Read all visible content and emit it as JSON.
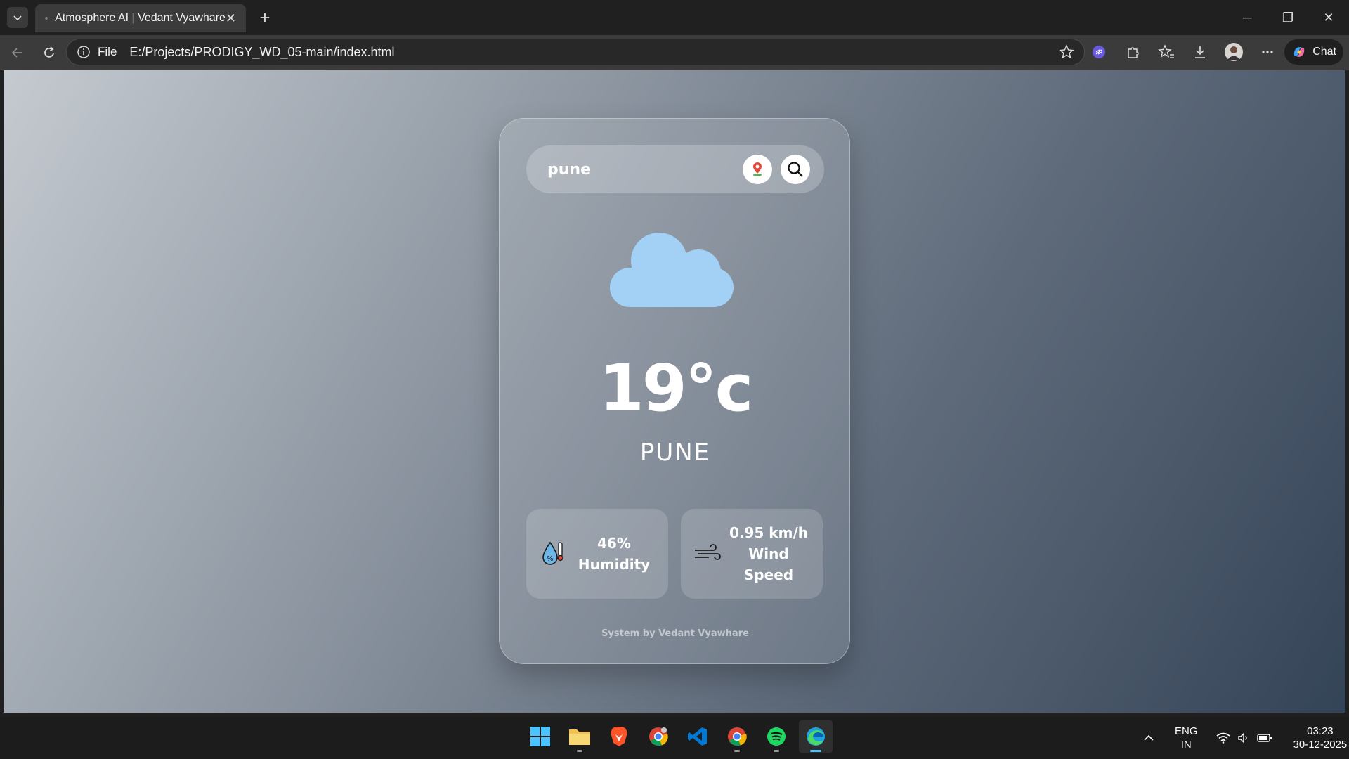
{
  "browser": {
    "tab_title": "Atmosphere AI | Vedant Vyawhare",
    "address_prefix": "File",
    "url": "E:/Projects/PRODIGY_WD_05-main/index.html",
    "chat_label": "Chat"
  },
  "app": {
    "search_value": "pune",
    "temperature": "19°c",
    "city": "PUNE",
    "humidity_value": "46%",
    "humidity_label": "Humidity",
    "wind_value": "0.95 km/h",
    "wind_label_1": "Wind",
    "wind_label_2": "Speed",
    "footer": "System by Vedant Vyawhare"
  },
  "taskbar": {
    "lang_1": "ENG",
    "lang_2": "IN",
    "time": "03:23",
    "date": "30-12-2025"
  },
  "colors": {
    "cloud": "#a3d0f5",
    "card_bg": "rgba(255,255,255,0.12)",
    "accent_active": "#4cc2ff"
  }
}
